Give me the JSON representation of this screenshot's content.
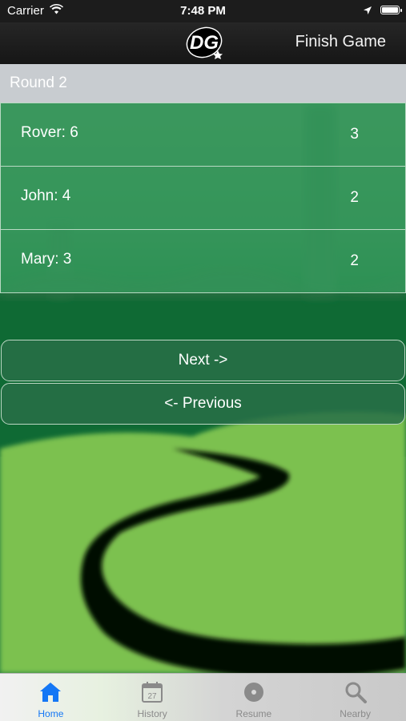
{
  "status_bar": {
    "carrier": "Carrier",
    "time": "7:48 PM"
  },
  "nav_bar": {
    "logo_text": "DG",
    "finish_label": "Finish Game"
  },
  "round": {
    "title": "Round 2"
  },
  "players": [
    {
      "name": "Rover: 6",
      "score": "3"
    },
    {
      "name": "John: 4",
      "score": "2"
    },
    {
      "name": "Mary: 3",
      "score": "2"
    }
  ],
  "buttons": {
    "next_label": "Next ->",
    "previous_label": "<- Previous"
  },
  "tabs": [
    {
      "label": "Home",
      "icon": "home-icon",
      "active": true
    },
    {
      "label": "History",
      "icon": "calendar-icon",
      "calendar_day": "27",
      "active": false
    },
    {
      "label": "Resume",
      "icon": "disc-icon",
      "active": false
    },
    {
      "label": "Nearby",
      "icon": "search-icon",
      "active": false
    }
  ],
  "colors": {
    "accent": "#1477f5",
    "grass_light": "#7cc150",
    "grass_dark": "#1f7a3f",
    "path": "#000000"
  }
}
